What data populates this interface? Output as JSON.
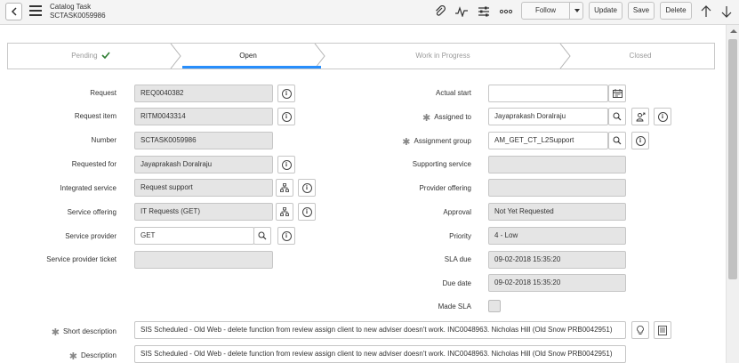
{
  "header": {
    "title": "Catalog Task",
    "number": "SCTASK0059986",
    "follow_label": "Follow",
    "update_label": "Update",
    "save_label": "Save",
    "delete_label": "Delete"
  },
  "process_flow": {
    "stages": [
      {
        "label": "Pending",
        "state": "done"
      },
      {
        "label": "Open",
        "state": "current"
      },
      {
        "label": "Work in Progress",
        "state": "future"
      },
      {
        "label": "Closed",
        "state": "future"
      }
    ]
  },
  "form": {
    "left": {
      "request": {
        "label": "Request",
        "value": "REQ0040382"
      },
      "request_item": {
        "label": "Request item",
        "value": "RITM0043314"
      },
      "number": {
        "label": "Number",
        "value": "SCTASK0059986"
      },
      "requested_for": {
        "label": "Requested for",
        "value": "Jayaprakash Doralraju"
      },
      "integrated_service": {
        "label": "Integrated service",
        "value": "Request support"
      },
      "service_offering": {
        "label": "Service offering",
        "value": "IT Requests (GET)"
      },
      "service_provider": {
        "label": "Service provider",
        "value": "GET"
      },
      "service_provider_ticket": {
        "label": "Service provider ticket",
        "value": ""
      }
    },
    "right": {
      "actual_start": {
        "label": "Actual start",
        "value": ""
      },
      "assigned_to": {
        "label": "Assigned to",
        "value": "Jayaprakash Doralraju"
      },
      "assignment_group": {
        "label": "Assignment group",
        "value": "AM_GET_CT_L2Support"
      },
      "supporting_service": {
        "label": "Supporting service",
        "value": ""
      },
      "provider_offering": {
        "label": "Provider offering",
        "value": ""
      },
      "approval": {
        "label": "Approval",
        "value": "Not Yet Requested"
      },
      "priority": {
        "label": "Priority",
        "value": "4 - Low"
      },
      "sla_due": {
        "label": "SLA due",
        "value": "09-02-2018 15:35:20"
      },
      "due_date": {
        "label": "Due date",
        "value": "09-02-2018 15:35:20"
      },
      "made_sla": {
        "label": "Made SLA",
        "checked": false
      }
    },
    "short_description": {
      "label": "Short description",
      "value": "SIS Scheduled - Old Web - delete function from review assign client to new adviser doesn't work. INC0048963. Nicholas Hill (Old Snow PRB0042951)"
    },
    "description": {
      "label": "Description",
      "value": "SIS Scheduled - Old Web - delete function from review assign client to new adviser doesn't work. INC0048963. Nicholas Hill (Old Snow PRB0042951)"
    }
  },
  "icons": {
    "back": "chevron-left-icon",
    "menu": "hamburger-icon",
    "attachment": "paperclip-icon",
    "activity": "pulse-icon",
    "settings": "sliders-icon",
    "more": "ellipsis-icon",
    "prev": "arrow-up-icon",
    "next": "arrow-down-icon"
  },
  "colors": {
    "accent": "#278efc",
    "check": "#2e7d32",
    "readonly_bg": "#e5e5e5"
  }
}
